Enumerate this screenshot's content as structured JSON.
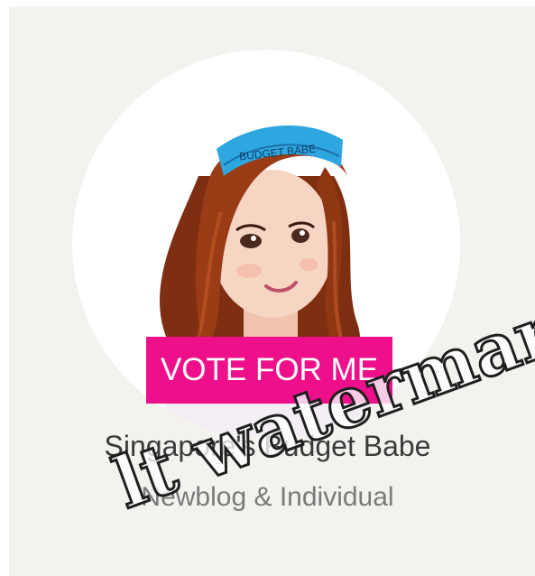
{
  "card": {
    "nav_text": [
      "",
      ""
    ],
    "avatar": {
      "description_icon": "cartoon-girl-avatar-icon",
      "headband_text": "BUDGET BABE",
      "colors": {
        "hair": "#8a3413",
        "headband": "#2aa3dd",
        "skin": "#f7d2bf",
        "top": "#f4f0f6"
      }
    },
    "vote_button": {
      "label": "VOTE FOR ME",
      "color": "#ee0f8a"
    },
    "blog_name": "Singapore's Budget Babe",
    "category": "Newblog & Individual"
  },
  "watermark": {
    "text": "lt watermark"
  }
}
